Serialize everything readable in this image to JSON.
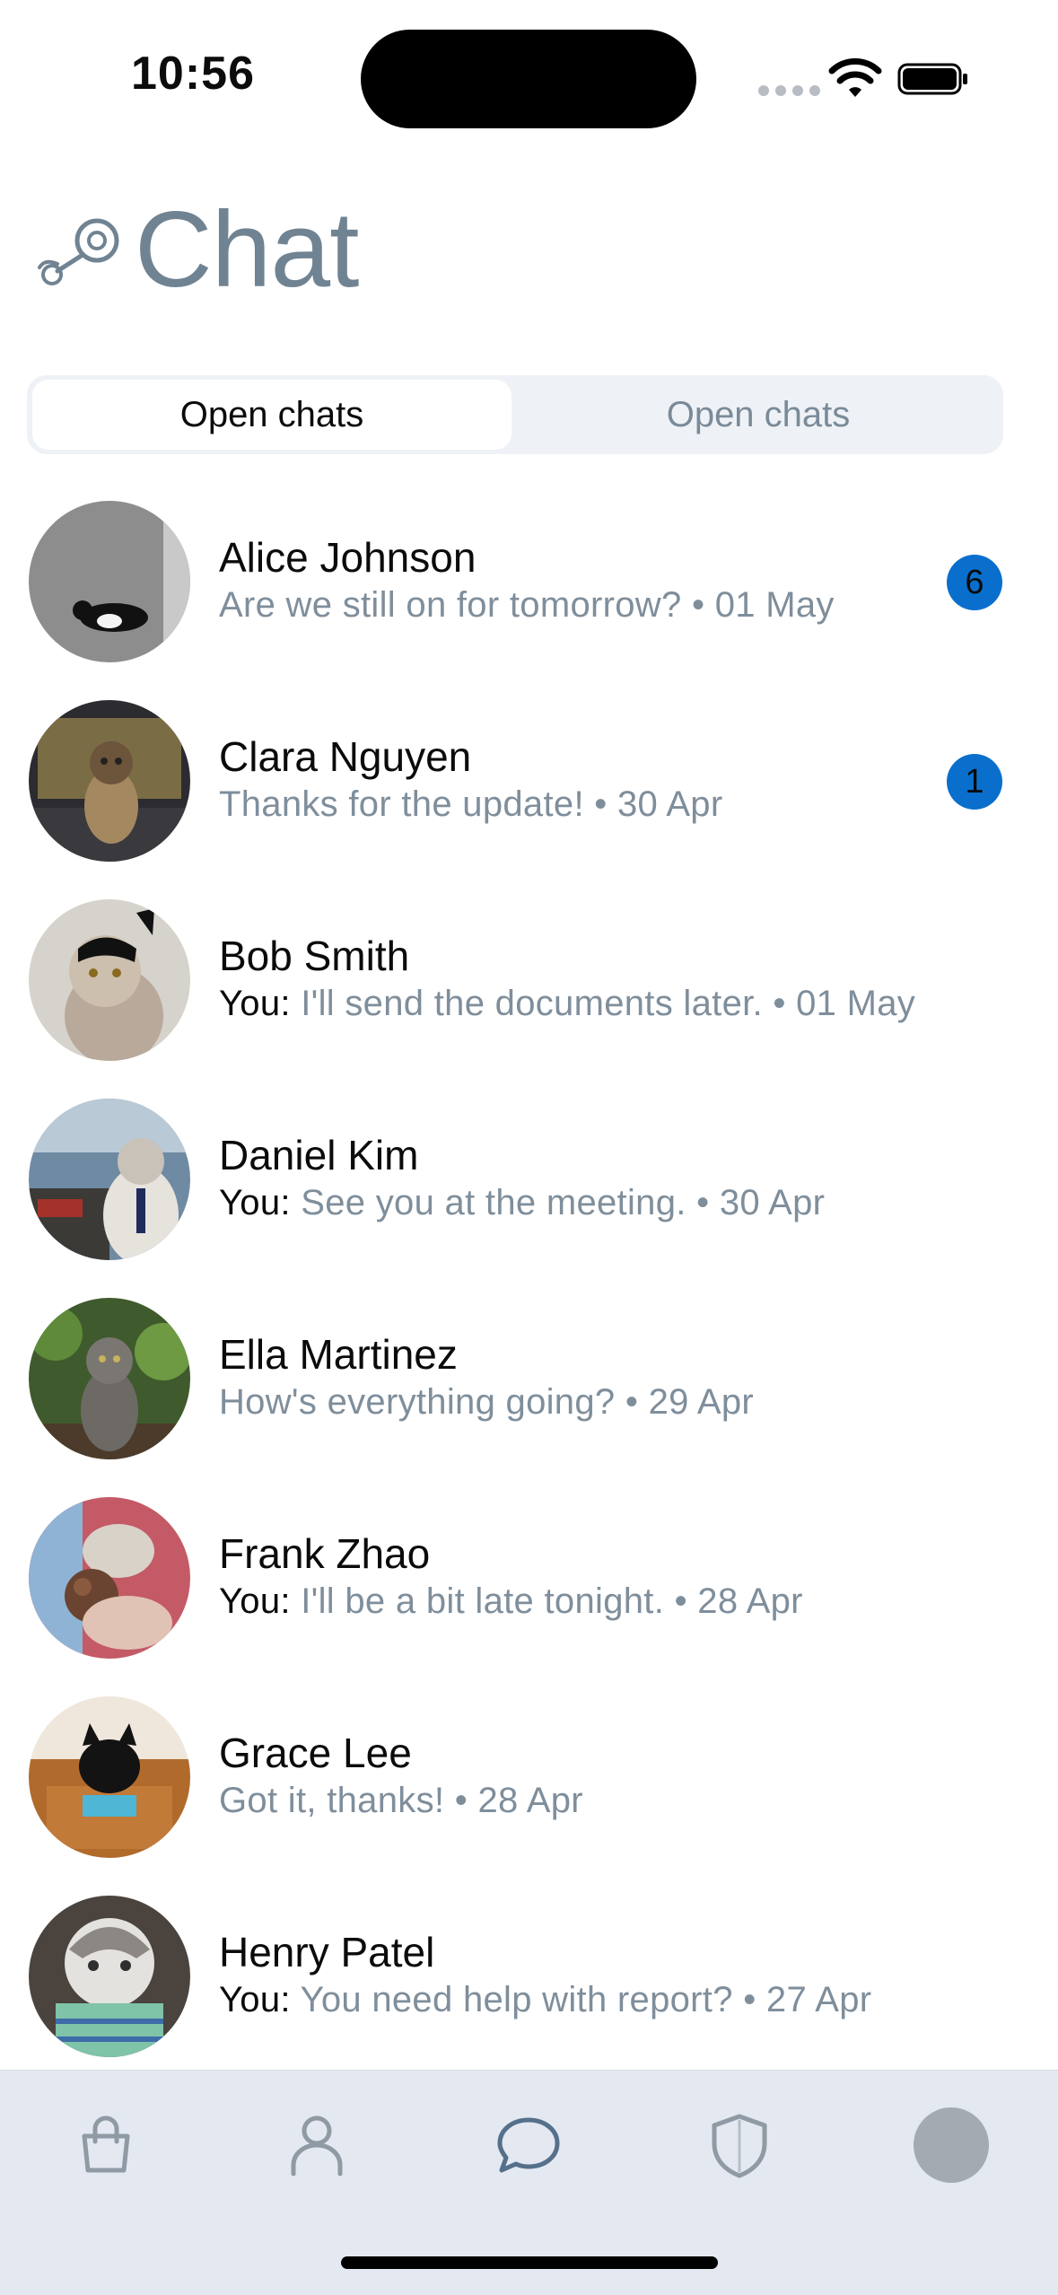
{
  "status_bar": {
    "time": "10:56"
  },
  "header": {
    "title": "Chat"
  },
  "segmented": {
    "tabs": [
      {
        "label": "Open chats"
      },
      {
        "label": "Open chats"
      }
    ]
  },
  "chats": [
    {
      "name": "Alice Johnson",
      "prefix": "",
      "message": "Are we still on for tomorrow?",
      "date": "01 May",
      "unread": "6"
    },
    {
      "name": "Clara Nguyen",
      "prefix": "",
      "message": "Thanks for the update!",
      "date": "30 Apr",
      "unread": "1"
    },
    {
      "name": "Bob Smith",
      "prefix": "You:",
      "message": "I'll send the documents later.",
      "date": "01 May",
      "unread": ""
    },
    {
      "name": "Daniel Kim",
      "prefix": "You:",
      "message": "See you at the meeting.",
      "date": "30 Apr",
      "unread": ""
    },
    {
      "name": "Ella Martinez",
      "prefix": "",
      "message": "How's everything going?",
      "date": "29 Apr",
      "unread": ""
    },
    {
      "name": "Frank Zhao",
      "prefix": "You:",
      "message": "I'll be a bit late tonight.",
      "date": "28 Apr",
      "unread": ""
    },
    {
      "name": "Grace Lee",
      "prefix": "",
      "message": "Got it, thanks!",
      "date": "28 Apr",
      "unread": ""
    },
    {
      "name": "Henry Patel",
      "prefix": "You:",
      "message": "You need help with report?",
      "date": "27 Apr",
      "unread": ""
    }
  ],
  "separator": "•",
  "tab_bar": {
    "items": [
      {
        "icon": "shopping-bag-icon"
      },
      {
        "icon": "person-icon"
      },
      {
        "icon": "chat-bubble-icon"
      },
      {
        "icon": "shield-icon"
      },
      {
        "icon": "profile-avatar-icon"
      }
    ]
  },
  "colors": {
    "accent": "#0a6fcc",
    "muted": "#7f8e9b",
    "title": "#708392",
    "tabbar": "#e4e8f1"
  }
}
